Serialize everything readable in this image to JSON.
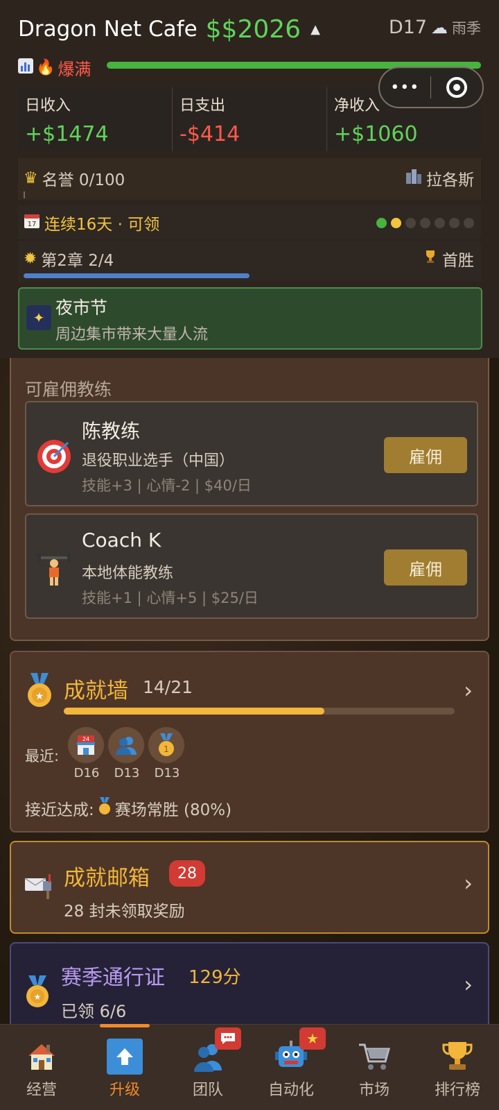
{
  "header": {
    "cafe_name": "Dragon Net Cafe",
    "money": "$$2026",
    "day": "D17",
    "weather": "雨季",
    "status_text": "爆满",
    "status_progress": 1.0
  },
  "stats": {
    "income_label": "日收入",
    "income_value": "+$1474",
    "expense_label": "日支出",
    "expense_value": "-$414",
    "net_label": "净收入",
    "net_value": "+$1060"
  },
  "fame": {
    "label": "名誉 0/100",
    "city": "拉各斯"
  },
  "streak": {
    "label": "连续16天 · 可领",
    "dots": [
      "green",
      "yellow",
      "gray",
      "gray",
      "gray",
      "gray",
      "gray"
    ]
  },
  "chapter": {
    "label": "第2章 2/4",
    "reward": "首胜",
    "progress": 0.5
  },
  "event": {
    "title": "夜市节",
    "desc": "周边集市带来大量人流"
  },
  "coaches": {
    "title": "可雇佣教练",
    "items": [
      {
        "name": "陈教练",
        "desc": "退役职业选手（中国）",
        "meta": "技能+3 | 心情-2 | $40/日",
        "hire": "雇佣",
        "icon": "target-icon"
      },
      {
        "name": "Coach K",
        "desc": "本地体能教练",
        "meta": "技能+1 | 心情+5 | $25/日",
        "hire": "雇佣",
        "icon": "weightlifter-icon"
      }
    ]
  },
  "achievements": {
    "title": "成就墙",
    "count": "14/21",
    "progress": 0.667,
    "recent_label": "最近:",
    "recent": [
      {
        "day": "D16",
        "icon": "convenience-store-icon"
      },
      {
        "day": "D13",
        "icon": "people-icon"
      },
      {
        "day": "D13",
        "icon": "medal-icon"
      }
    ],
    "near_label": "接近达成:",
    "near_text": "赛场常胜 (80%)"
  },
  "mailbox": {
    "title": "成就邮箱",
    "badge": "28",
    "desc": "28 封未领取奖励"
  },
  "season_pass": {
    "title": "赛季通行证",
    "points": "129分",
    "desc": "已领 6/6"
  },
  "nav": {
    "items": [
      {
        "label": "经营",
        "icon": "house-icon"
      },
      {
        "label": "升级",
        "icon": "up-arrow-icon"
      },
      {
        "label": "团队",
        "icon": "team-icon"
      },
      {
        "label": "自动化",
        "icon": "robot-icon"
      },
      {
        "label": "市场",
        "icon": "cart-icon"
      },
      {
        "label": "排行榜",
        "icon": "trophy-icon"
      }
    ],
    "active_index": 1
  },
  "colors": {
    "positive": "#5fd45a",
    "negative": "#ff5a4a",
    "accent": "#f2b63a",
    "active_tab": "#f08a2a"
  }
}
